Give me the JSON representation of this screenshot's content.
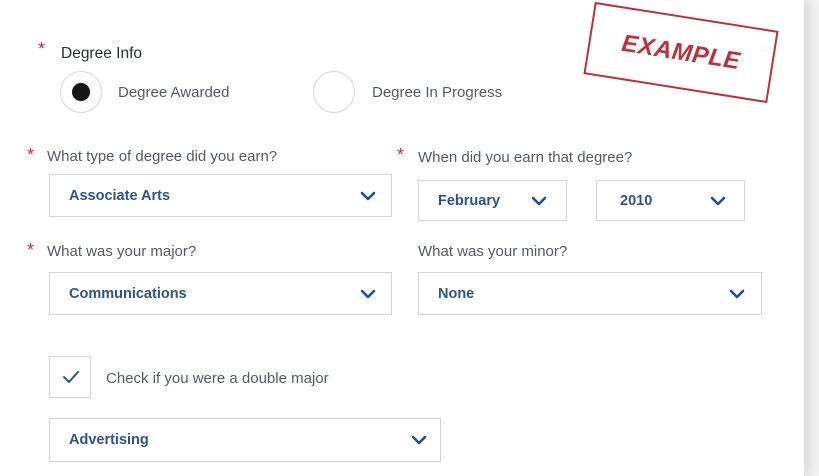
{
  "degree_info": {
    "label": "Degree Info",
    "required_mark": "*",
    "options": [
      {
        "label": "Degree Awarded",
        "selected": true
      },
      {
        "label": "Degree In Progress",
        "selected": false
      }
    ]
  },
  "degree_type": {
    "label": "What type of degree did you earn?",
    "required_mark": "*",
    "value": "Associate Arts"
  },
  "earned_date": {
    "label": "When did you earn that degree?",
    "required_mark": "*",
    "month": "February",
    "year": "2010"
  },
  "major": {
    "label": "What was your major?",
    "required_mark": "*",
    "value": "Communications"
  },
  "minor": {
    "label": "What was your minor?",
    "value": "None"
  },
  "double_major": {
    "label": "Check if you were a double major",
    "checked": true,
    "second_major": "Advertising"
  },
  "stamp": {
    "text": "EXAMPLE"
  },
  "colors": {
    "required": "#b8323f",
    "value_text": "#2c5487",
    "chevron": "#1f4f8a",
    "stamp": "#b8323f"
  },
  "icons": {
    "select_arrow": "chevron-down-icon",
    "checkbox_mark": "checkmark-icon",
    "radio_selected": "radio-dot-icon"
  }
}
